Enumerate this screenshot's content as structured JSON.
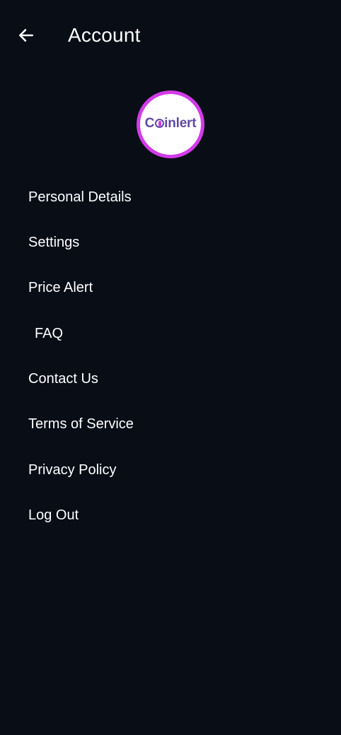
{
  "header": {
    "title": "Account",
    "back_icon": "arrow-left-icon"
  },
  "profile": {
    "logo": {
      "brand_text": "Coinlert",
      "prefix": "C",
      "suffix": "inlert",
      "brand_color": "#5f4aa3",
      "accent_color": "#d23ce8"
    }
  },
  "menu": {
    "items": [
      {
        "label": "Personal Details"
      },
      {
        "label": "Settings"
      },
      {
        "label": "Price Alert"
      },
      {
        "label": "FAQ"
      },
      {
        "label": "Contact Us"
      },
      {
        "label": "Terms of Service"
      },
      {
        "label": "Privacy Policy"
      },
      {
        "label": "Log Out"
      }
    ]
  },
  "theme": {
    "background": "#080d16",
    "text": "#ffffff"
  }
}
